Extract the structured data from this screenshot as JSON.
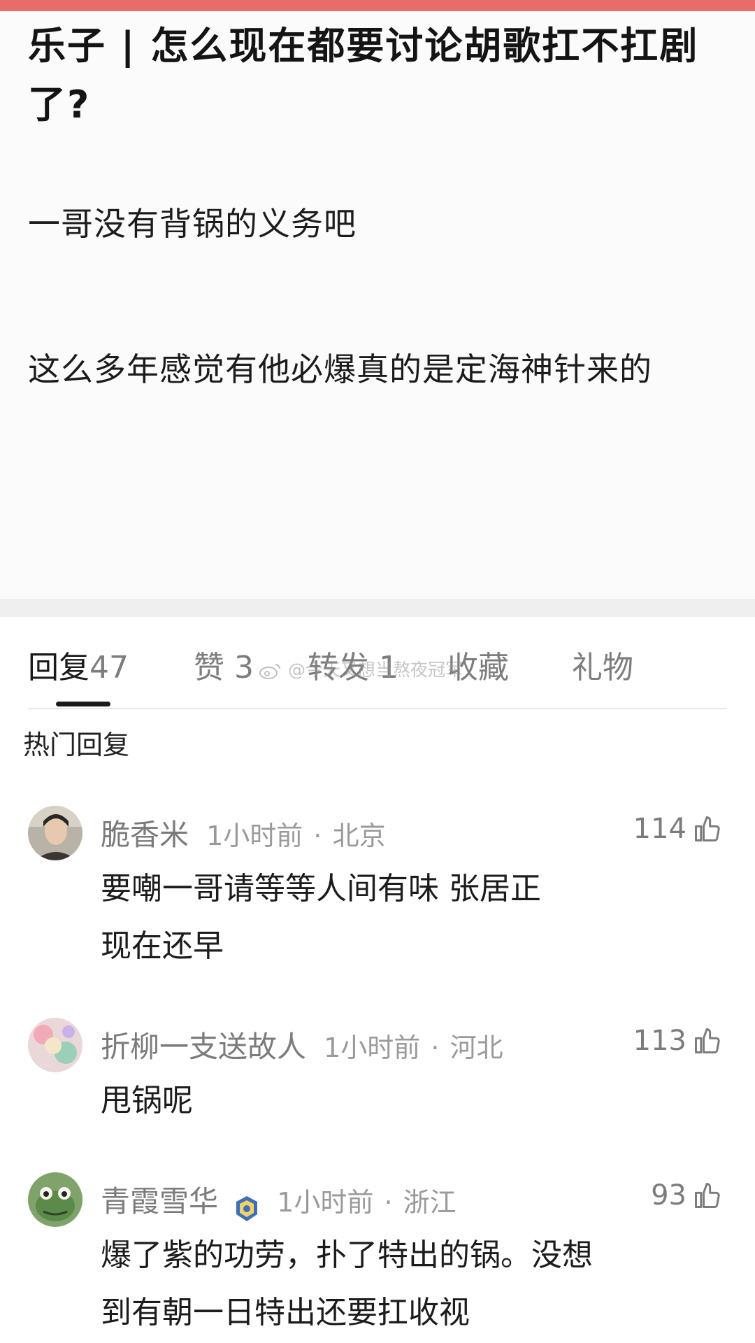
{
  "post": {
    "title": "乐子 | 怎么现在都要讨论胡歌扛不扛剧了?",
    "paragraphs": [
      "一哥没有背锅的义务吧",
      "这么多年感觉有他必爆真的是定海神针来的"
    ]
  },
  "tabs": [
    {
      "label": "回复",
      "count": "47"
    },
    {
      "label": "赞",
      "count": "3"
    },
    {
      "label": "转发",
      "count": "1"
    },
    {
      "label": "收藏",
      "count": ""
    },
    {
      "label": "礼物",
      "count": ""
    }
  ],
  "watermark": "@今天又想当熬夜冠军",
  "section_heading": "热门回复",
  "comments": [
    {
      "name": "脆香米",
      "time": "1小时前",
      "location": "北京",
      "likes": "114",
      "text": "要嘲一哥请等等人间有味 张居正现在还早"
    },
    {
      "name": "折柳一支送故人",
      "time": "1小时前",
      "location": "河北",
      "likes": "113",
      "text": "甩锅呢"
    },
    {
      "name": "青霞雪华",
      "time": "1小时前",
      "location": "浙江",
      "likes": "93",
      "text": "爆了紫的功劳，扑了特出的锅。没想到有朝一日特出还要扛收视"
    }
  ],
  "colors": {
    "top_strip": "#e86d6a",
    "divider_band": "#efefef",
    "text_primary": "#1c1c1c",
    "text_secondary": "#7b7b7b"
  }
}
